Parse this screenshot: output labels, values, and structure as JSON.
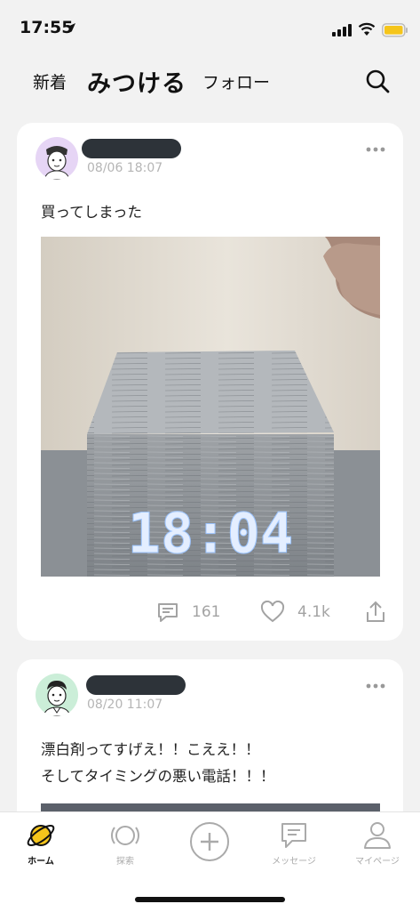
{
  "status_bar": {
    "time": "17:55"
  },
  "top_nav": {
    "tabs": [
      {
        "label": "新着"
      },
      {
        "label": "みつける"
      },
      {
        "label": "フォロー"
      }
    ]
  },
  "posts": [
    {
      "time": "08/06 18:07",
      "text": "買ってしまった",
      "clock_display": "18:04",
      "comments": "161",
      "likes": "4.1k"
    },
    {
      "time": "08/20 11:07",
      "text_lines": [
        "漂白剤ってすげえ！！こええ！！",
        "そしてタイミングの悪い電話！！！"
      ]
    }
  ],
  "tab_bar": {
    "items": [
      {
        "label": "ホーム",
        "icon": "planet-icon"
      },
      {
        "label": "探索",
        "icon": "orbit-icon"
      },
      {
        "label": "",
        "icon": "plus-icon"
      },
      {
        "label": "メッセージ",
        "icon": "message-icon"
      },
      {
        "label": "マイページ",
        "icon": "person-icon"
      }
    ]
  },
  "colors": {
    "accent": "#f5c51b",
    "text": "#222222",
    "muted": "#a3a3a3",
    "background": "#f2f2f2"
  }
}
